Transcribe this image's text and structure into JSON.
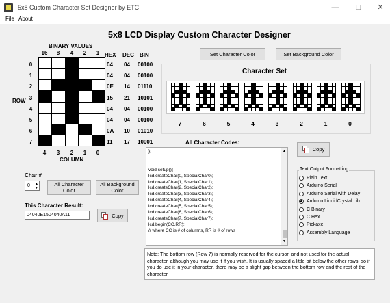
{
  "window": {
    "title": "5x8 Custom Character Set Designer by ETC",
    "controls": {
      "minimize": "—",
      "maximize": "□",
      "close": "✕"
    }
  },
  "menu": [
    "File",
    "About"
  ],
  "heading": "5x8 LCD Display Custom Character Designer",
  "grid_labels": {
    "binary_values": "BINARY VALUES",
    "top_cols": [
      "16",
      "8",
      "4",
      "2",
      "1"
    ],
    "bottom_cols": [
      "4",
      "3",
      "2",
      "1",
      "0"
    ],
    "column": "COLUMN",
    "row": "ROW",
    "row_nums": [
      "0",
      "1",
      "2",
      "3",
      "4",
      "5",
      "6",
      "7"
    ]
  },
  "grid_cells": [
    [
      0,
      0,
      1,
      0,
      0
    ],
    [
      0,
      0,
      1,
      0,
      0
    ],
    [
      0,
      1,
      1,
      1,
      0
    ],
    [
      1,
      0,
      1,
      0,
      1
    ],
    [
      0,
      0,
      1,
      0,
      0
    ],
    [
      0,
      0,
      1,
      0,
      0
    ],
    [
      0,
      1,
      0,
      1,
      0
    ],
    [
      1,
      0,
      0,
      0,
      1
    ]
  ],
  "value_table": {
    "headers": [
      "HEX",
      "DEC",
      "BIN"
    ],
    "rows": [
      [
        "04",
        "04",
        "00100"
      ],
      [
        "04",
        "04",
        "00100"
      ],
      [
        "0E",
        "14",
        "01110"
      ],
      [
        "15",
        "21",
        "10101"
      ],
      [
        "04",
        "04",
        "00100"
      ],
      [
        "04",
        "04",
        "00100"
      ],
      [
        "0A",
        "10",
        "01010"
      ],
      [
        "11",
        "17",
        "10001"
      ]
    ]
  },
  "buttons": {
    "set_char_color": "Set Character Color",
    "set_bg_color": "Set Background Color",
    "all_char_color": "All Character Color",
    "all_bg_color": "All Background Color",
    "copy": "Copy"
  },
  "character_set": {
    "title": "Character Set",
    "labels": [
      "7",
      "6",
      "5",
      "4",
      "3",
      "2",
      "1",
      "0"
    ]
  },
  "char_number": {
    "label": "Char #",
    "value": "0"
  },
  "result": {
    "label": "This Character Result:",
    "value": "04040E1504040A11"
  },
  "codes": {
    "label": "All Character Codes:",
    "lines": [
      "};",
      "",
      "",
      "void setup(){",
      "lcd.createChar(0, SpecialChar0);",
      "lcd.createChar(1, SpecialChar1);",
      "lcd.createChar(2, SpecialChar2);",
      "lcd.createChar(3, SpecialChar3);",
      "lcd.createChar(4, SpecialChar4);",
      "lcd.createChar(5, SpecialChar5);",
      "lcd.createChar(6, SpecialChar6);",
      "lcd.createChar(7, SpecialChar7);",
      "lcd.begin(CC,RR);",
      "// where CC is # of columns, RR is # of rows"
    ]
  },
  "text_output": {
    "title": "Text Output Formatting",
    "options": [
      "Plain Text",
      "Arduino Serial",
      "Arduino Serial with Delay",
      "Arduino LiquidCrystal Lib",
      "C Binary",
      "C Hex",
      "Pickaxe",
      "Assembly Language"
    ],
    "selected_index": 3
  },
  "note": "Note: The bottom row (Row 7) is normally reserved for the cursor, and not used for the actual character, although you may use it if you wish. It is usually spaced a little bit below the other rows, so if you do use it in your character, there may be a slight gap between the bottom row and the rest of the character."
}
